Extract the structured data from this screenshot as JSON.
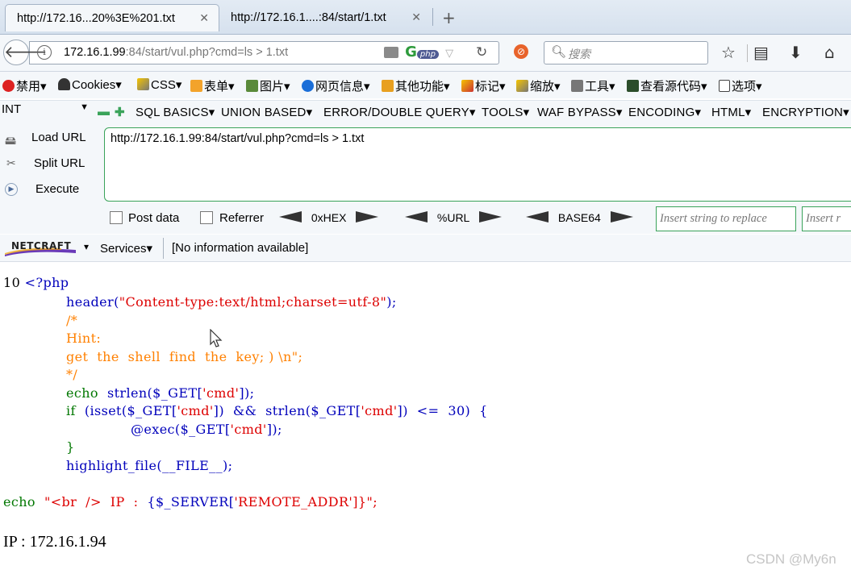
{
  "tabs": [
    {
      "label": "http://172.16...20%3E%201.txt",
      "active": true
    },
    {
      "label": "http://172.16.1....:84/start/1.txt",
      "active": false
    }
  ],
  "nav": {
    "url_host": "172.16.1.99",
    "url_rest": ":84/start/vul.php?cmd=ls > 1.txt",
    "url_prefix": "",
    "php_badge": "php",
    "search_placeholder": "搜索"
  },
  "bookmarks": [
    "禁用",
    "Cookies",
    "CSS",
    "表单",
    "图片",
    "网页信息",
    "其他功能",
    "标记",
    "缩放",
    "工具",
    "查看源代码",
    "选项"
  ],
  "hackbar": {
    "type_select": "INT",
    "menu": [
      "SQL BASICS",
      "UNION BASED",
      "ERROR/DOUBLE QUERY",
      "TOOLS",
      "WAF BYPASS",
      "ENCODING",
      "HTML",
      "ENCRYPTION"
    ],
    "load_url": "Load URL",
    "split_url": "Split URL",
    "execute": "Execute",
    "url_value": "http://172.16.1.99:84/start/vul.php?cmd=ls > 1.txt",
    "post_data": "Post data",
    "referrer": "Referrer",
    "hex": "0xHEX",
    "url_enc": "%URL",
    "base64": "BASE64",
    "replace_placeholder": "Insert string to replace",
    "replace_with_placeholder": "Insert r"
  },
  "netcraft": {
    "logo": "NETCRAFT",
    "services": "Services",
    "info": "[No information available]"
  },
  "page": {
    "line1_prefix": "10 ",
    "line1_php": "<?php",
    "header_fn": "header(",
    "header_str": "\"Content-type:text/html;charset=utf-8\"",
    "header_end": ");",
    "c_open": "/*",
    "c_hint": "Hint:",
    "c_body": "get  the  shell  find  the  key; ) \\n\";",
    "c_close": "*/",
    "echo_kw": "echo  ",
    "echo_rest": "strlen($_GET[",
    "echo_key": "'cmd'",
    "echo_end": "]);",
    "if_kw": "if  ",
    "if_rest1": "(isset($_GET[",
    "if_key1": "'cmd'",
    "if_rest2": "])  &&  strlen($_GET[",
    "if_key2": "'cmd'",
    "if_rest3": "])  <=  30)  {",
    "exec_rest": "@exec($_GET[",
    "exec_key": "'cmd'",
    "exec_end": "]);",
    "brace": "}",
    "hl": "highlight_file(__FILE__);",
    "echo2_kw": "echo  ",
    "echo2_str": "\"<br  />  IP  :  ",
    "echo2_var": "{$_SERVER[",
    "echo2_key": "'REMOTE_ADDR'",
    "echo2_end": "]}\";",
    "ip_line": "IP : 172.16.1.94"
  },
  "watermark": "CSDN @My6n"
}
